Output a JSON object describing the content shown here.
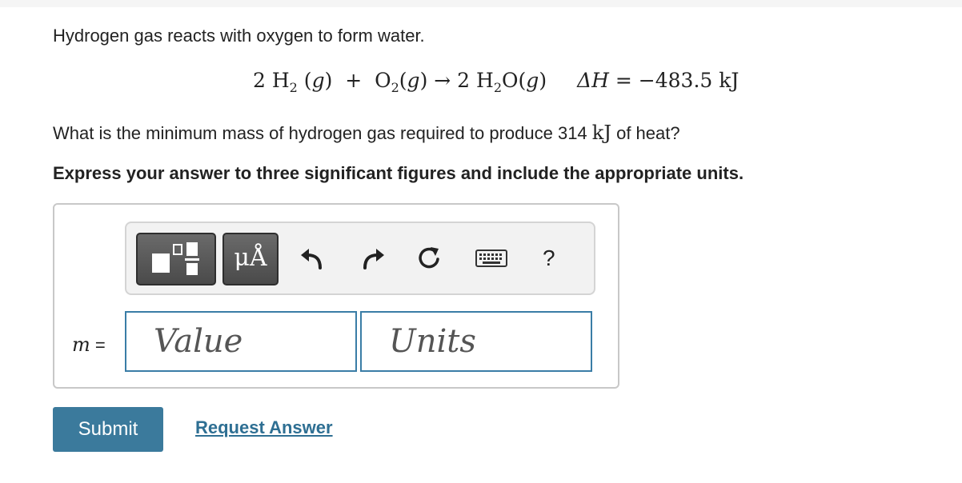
{
  "problem": {
    "intro": "Hydrogen gas reacts with oxygen to form water.",
    "equation": {
      "coef_h2": "2",
      "h2": "H",
      "h2_sub": "2",
      "phase_gas": "g",
      "plus": "+",
      "o2": "O",
      "o2_sub": "2",
      "arrow": "→",
      "coef_h2o": "2",
      "h2o_h": "H",
      "h2o_sub": "2",
      "h2o_o": "O",
      "delta_h": "ΔH",
      "equals": "=",
      "delta_h_value": "−483.5 kJ"
    },
    "question_before": "What is the minimum mass of hydrogen gas required to produce 314 ",
    "question_unit": "kJ",
    "question_after": " of heat?",
    "instruction": "Express your answer to three significant figures and include the appropriate units."
  },
  "toolbar": {
    "templates_icon": "fraction-template-icon",
    "units_label": "μÅ",
    "undo_icon": "undo-arrow-icon",
    "redo_icon": "redo-arrow-icon",
    "reset_icon": "reset-icon",
    "keyboard_icon": "keyboard-icon",
    "help_label": "?"
  },
  "answer": {
    "variable": "m",
    "equals": "=",
    "value_placeholder": "Value",
    "units_placeholder": "Units"
  },
  "actions": {
    "submit_label": "Submit",
    "request_answer_label": "Request Answer"
  },
  "colors": {
    "field_border": "#3a7da6",
    "submit_bg": "#3b7a9c",
    "link": "#2e6f93",
    "toolbar_button": "#555555"
  }
}
